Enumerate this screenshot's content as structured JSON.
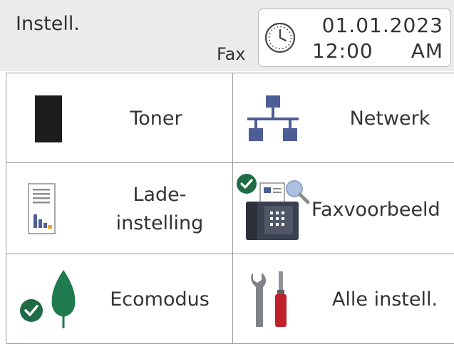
{
  "header": {
    "title": "Instell.",
    "fax_label": "Fax",
    "date": "01.01.2023",
    "time": "12:00",
    "ampm": "AM"
  },
  "tiles": {
    "toner": {
      "label": "Toner"
    },
    "network": {
      "label": "Netwerk"
    },
    "charge": {
      "line1": "Lade-",
      "line2": "instelling"
    },
    "fax_preview": {
      "label": "Faxvoorbeeld"
    },
    "eco": {
      "label": "Ecomodus"
    },
    "all_settings": {
      "label": "Alle instell."
    }
  },
  "colors": {
    "header_bg": "#ebebeb",
    "check_green": "#1f6b45",
    "network_blue": "#4d5d96",
    "toner_black": "#1d1d1d",
    "leaf_green": "#1f7a4f",
    "screwdriver_red": "#c0202a"
  }
}
